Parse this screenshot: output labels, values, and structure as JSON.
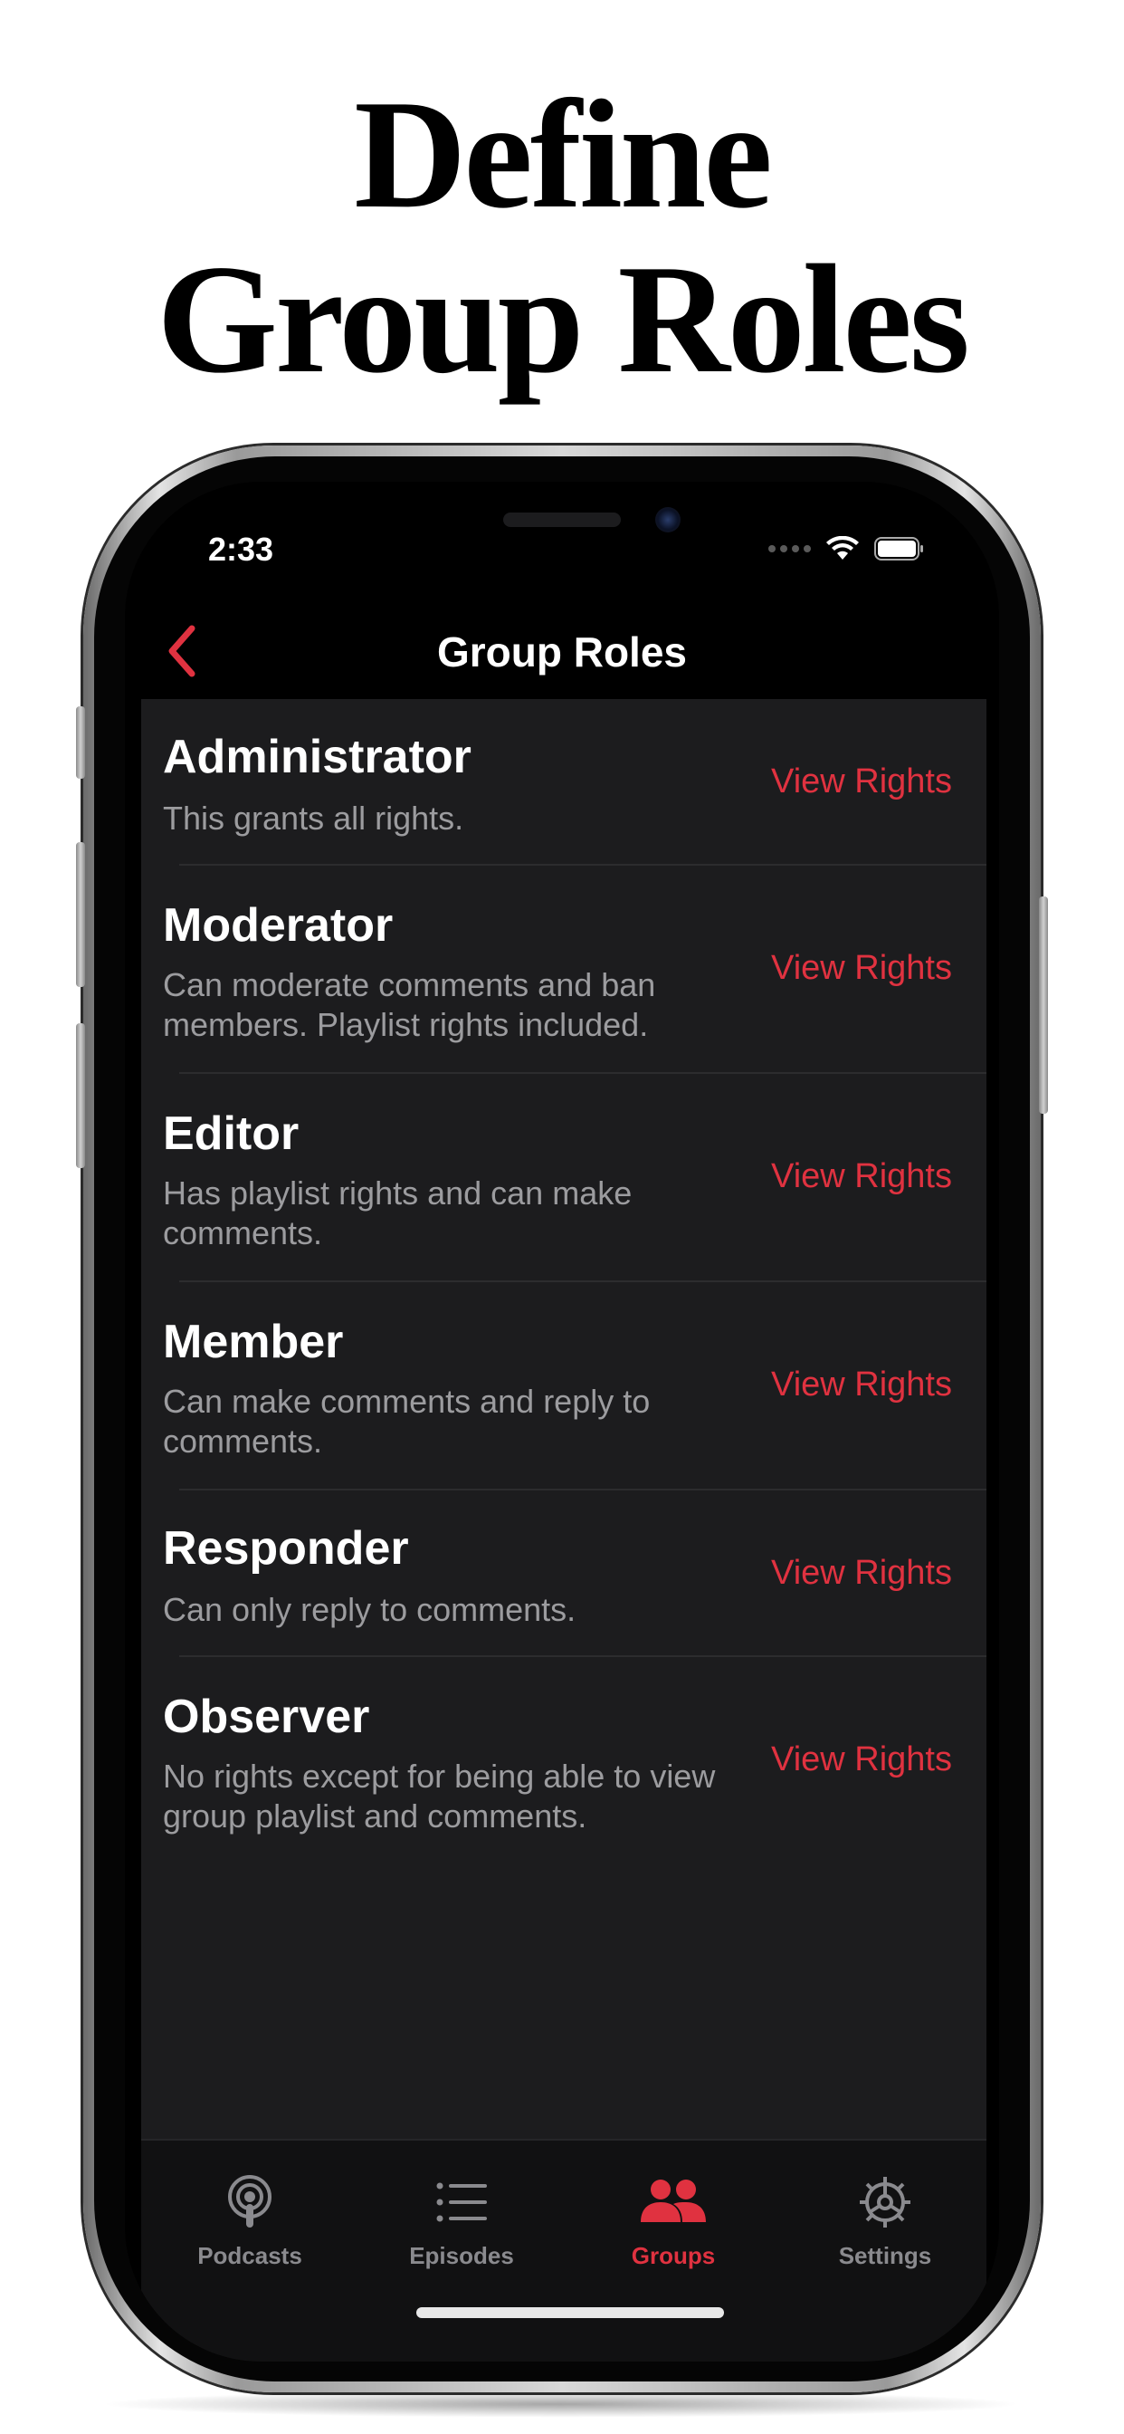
{
  "headline": {
    "line1": "Define",
    "line2": "Group Roles"
  },
  "status_bar": {
    "time": "2:33"
  },
  "nav": {
    "title": "Group Roles"
  },
  "roles": [
    {
      "title": "Administrator",
      "description": "This grants all rights.",
      "action": "View Rights"
    },
    {
      "title": "Moderator",
      "description": "Can moderate comments and ban members. Playlist rights included.",
      "action": "View Rights"
    },
    {
      "title": "Editor",
      "description": "Has playlist rights and can make comments.",
      "action": "View Rights"
    },
    {
      "title": "Member",
      "description": "Can make comments and reply to comments.",
      "action": "View Rights"
    },
    {
      "title": "Responder",
      "description": "Can only reply to comments.",
      "action": "View Rights"
    },
    {
      "title": "Observer",
      "description": "No rights except for being able to view group playlist and comments.",
      "action": "View Rights"
    }
  ],
  "tabs": [
    {
      "label": "Podcasts",
      "icon": "podcast-icon"
    },
    {
      "label": "Episodes",
      "icon": "list-icon"
    },
    {
      "label": "Groups",
      "icon": "people-icon"
    },
    {
      "label": "Settings",
      "icon": "gear-icon"
    }
  ],
  "active_tab": "Groups",
  "colors": {
    "accent": "#e03240",
    "list_bg": "#1c1c1e",
    "screen_bg": "#000000"
  }
}
